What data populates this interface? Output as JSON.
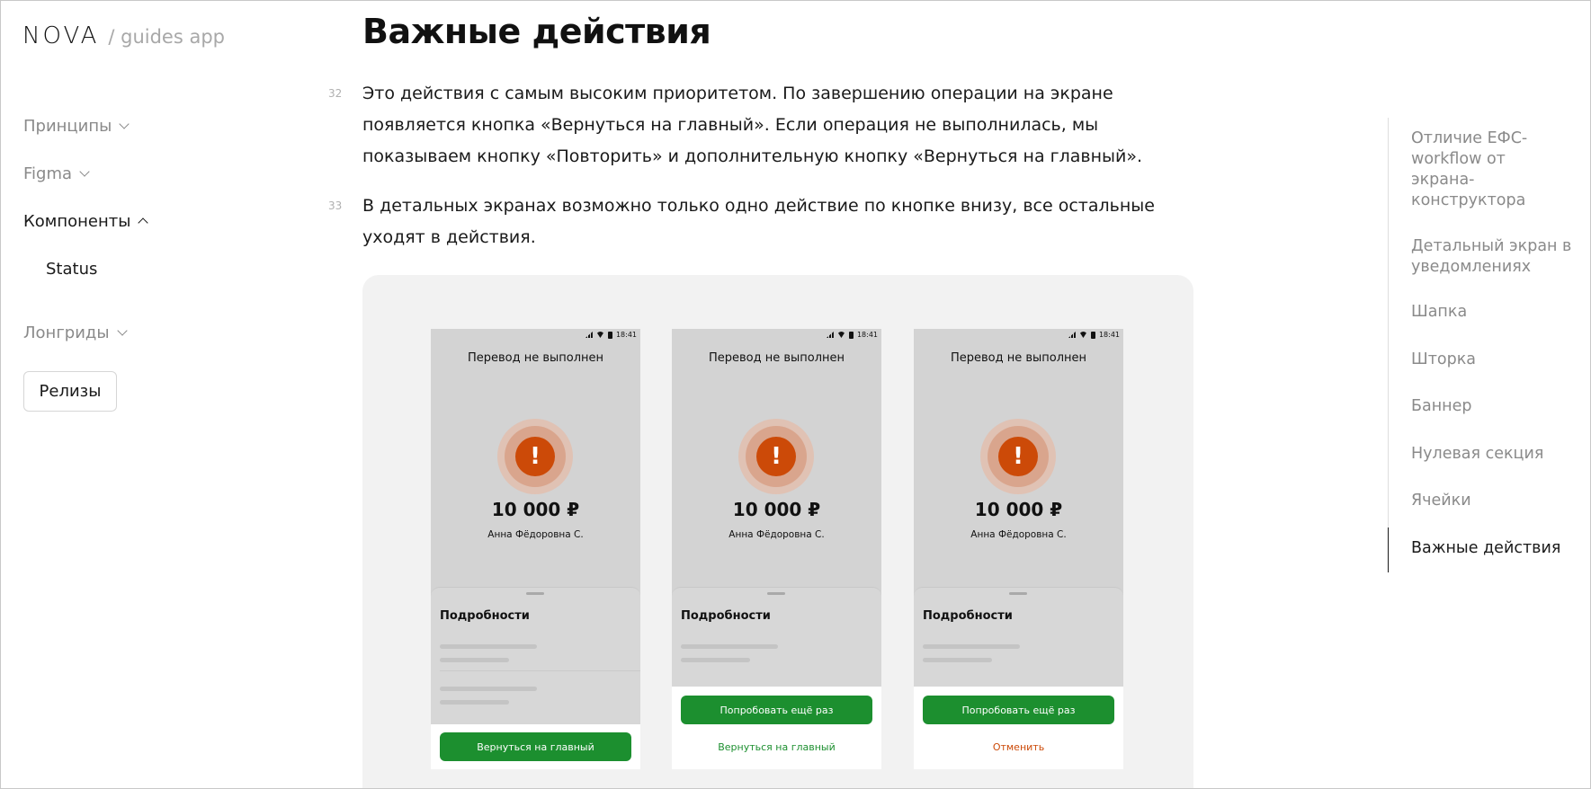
{
  "logo": {
    "brand": "NOVA",
    "sub": "/ guides app"
  },
  "nav": {
    "items": [
      {
        "label": "Принципы"
      },
      {
        "label": "Figma"
      },
      {
        "label": "Компоненты"
      },
      {
        "label": "Лонгриды"
      }
    ],
    "sub_items": [
      {
        "label": "Status"
      }
    ],
    "releases_label": "Релизы"
  },
  "main": {
    "title": "Важные действия",
    "paragraphs": [
      {
        "num": "32",
        "text": "Это действия с самым высоким приоритетом. По завершению операции на экране появляется кнопка «Вернуться на главный». Если операция не выполнилась, мы показываем кнопку «Повторить» и дополнительную кнопку «Вернуться на главный»."
      },
      {
        "num": "33",
        "text": "В детальных экранах возможно только одно действие по кнопке внизу, все остальные уходят в действия."
      }
    ]
  },
  "phones": [
    {
      "time": "18:41",
      "title": "Перевод не выполнен",
      "amount": "10 000 ₽",
      "recipient": "Анна Фёдоровна С.",
      "sheet_title": "Подробности",
      "primary": "Вернуться на главный",
      "secondary": ""
    },
    {
      "time": "18:41",
      "title": "Перевод не выполнен",
      "amount": "10 000 ₽",
      "recipient": "Анна Фёдоровна С.",
      "sheet_title": "Подробности",
      "primary": "Попробовать ещё раз",
      "secondary": "Вернуться на главный"
    },
    {
      "time": "18:41",
      "title": "Перевод не выполнен",
      "amount": "10 000 ₽",
      "recipient": "Анна Фёдоровна С.",
      "sheet_title": "Подробности",
      "primary": "Попробовать ещё раз",
      "secondary": "Отменить"
    }
  ],
  "toc": {
    "items": [
      {
        "label": "Отличие ЕФС-workflow от экрана-конструктора"
      },
      {
        "label": "Детальный экран в уведомлениях"
      },
      {
        "label": "Шапка"
      },
      {
        "label": "Шторка"
      },
      {
        "label": "Баннер"
      },
      {
        "label": "Нулевая секция"
      },
      {
        "label": "Ячейки"
      },
      {
        "label": "Важные действия"
      }
    ],
    "active": "Важные действия"
  },
  "colors": {
    "accent_green": "#1c8f2f",
    "error_orange": "#cc4a08",
    "cancel_orange": "#cc4a08"
  }
}
